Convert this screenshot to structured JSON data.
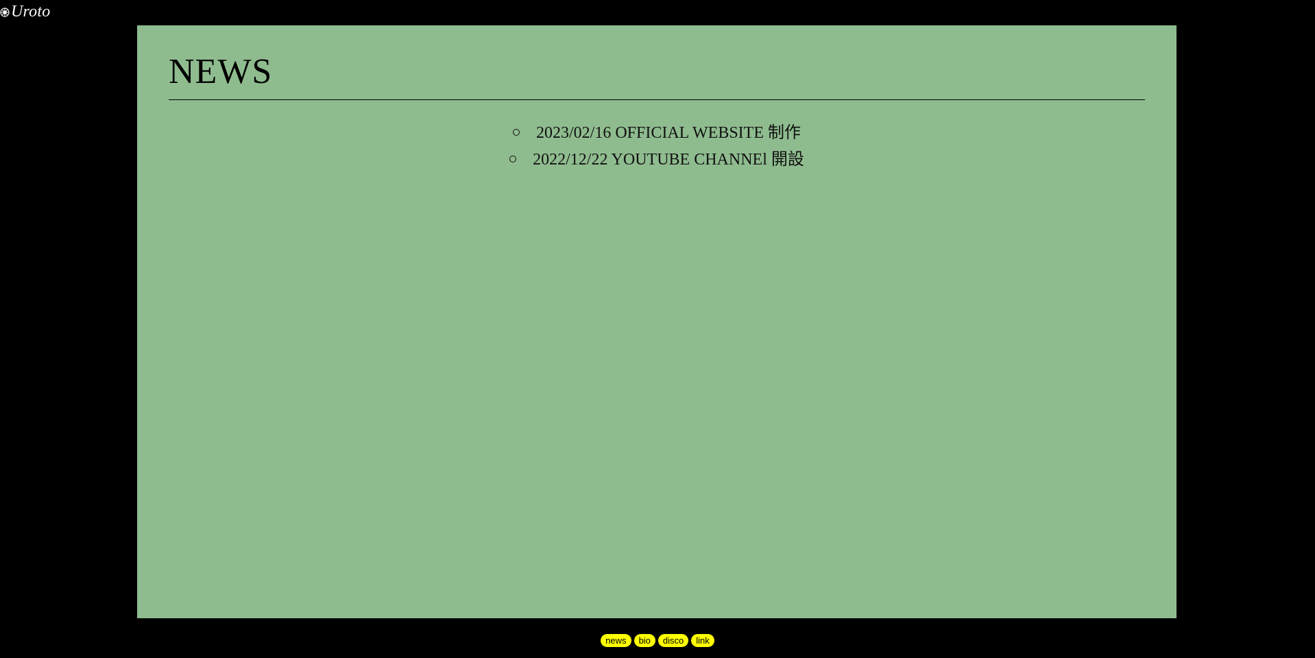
{
  "header": {
    "logo_icon": "cog-flower-icon",
    "brand": "Uroto"
  },
  "main": {
    "title": "NEWS",
    "items": [
      {
        "text": "2023/02/16 OFFICIAL WEBSITE 制作"
      },
      {
        "text": "2022/12/22 YOUTUBE CHANNEl 開設"
      }
    ]
  },
  "nav": {
    "items": [
      {
        "label": "news"
      },
      {
        "label": "bio"
      },
      {
        "label": "disco"
      },
      {
        "label": "link"
      }
    ]
  },
  "colors": {
    "page_background": "#000000",
    "panel_background": "#8fbc8f",
    "nav_button": "#ffff00",
    "brand_text": "#ffffff"
  }
}
